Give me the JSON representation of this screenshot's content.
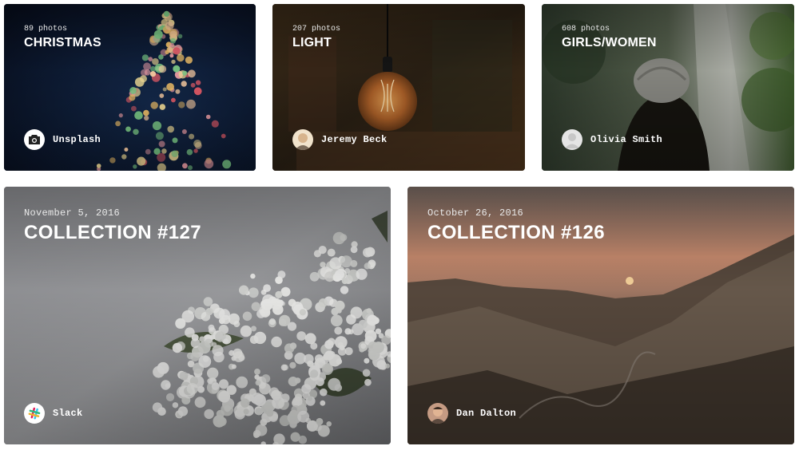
{
  "collections": [
    {
      "meta": "89 photos",
      "title": "CHRISTMAS",
      "author": "Unsplash",
      "avatar_icon": "camera-icon"
    },
    {
      "meta": "207 photos",
      "title": "LIGHT",
      "author": "Jeremy Beck",
      "avatar_icon": "user-avatar"
    },
    {
      "meta": "608 photos",
      "title": "GIRLS/WOMEN",
      "author": "Olivia Smith",
      "avatar_icon": "default-user-icon"
    },
    {
      "meta": "November 5, 2016",
      "title": "COLLECTION #127",
      "author": "Slack",
      "avatar_icon": "slack-logo-icon"
    },
    {
      "meta": "October 26, 2016",
      "title": "COLLECTION #126",
      "author": "Dan Dalton",
      "avatar_icon": "user-avatar"
    }
  ]
}
